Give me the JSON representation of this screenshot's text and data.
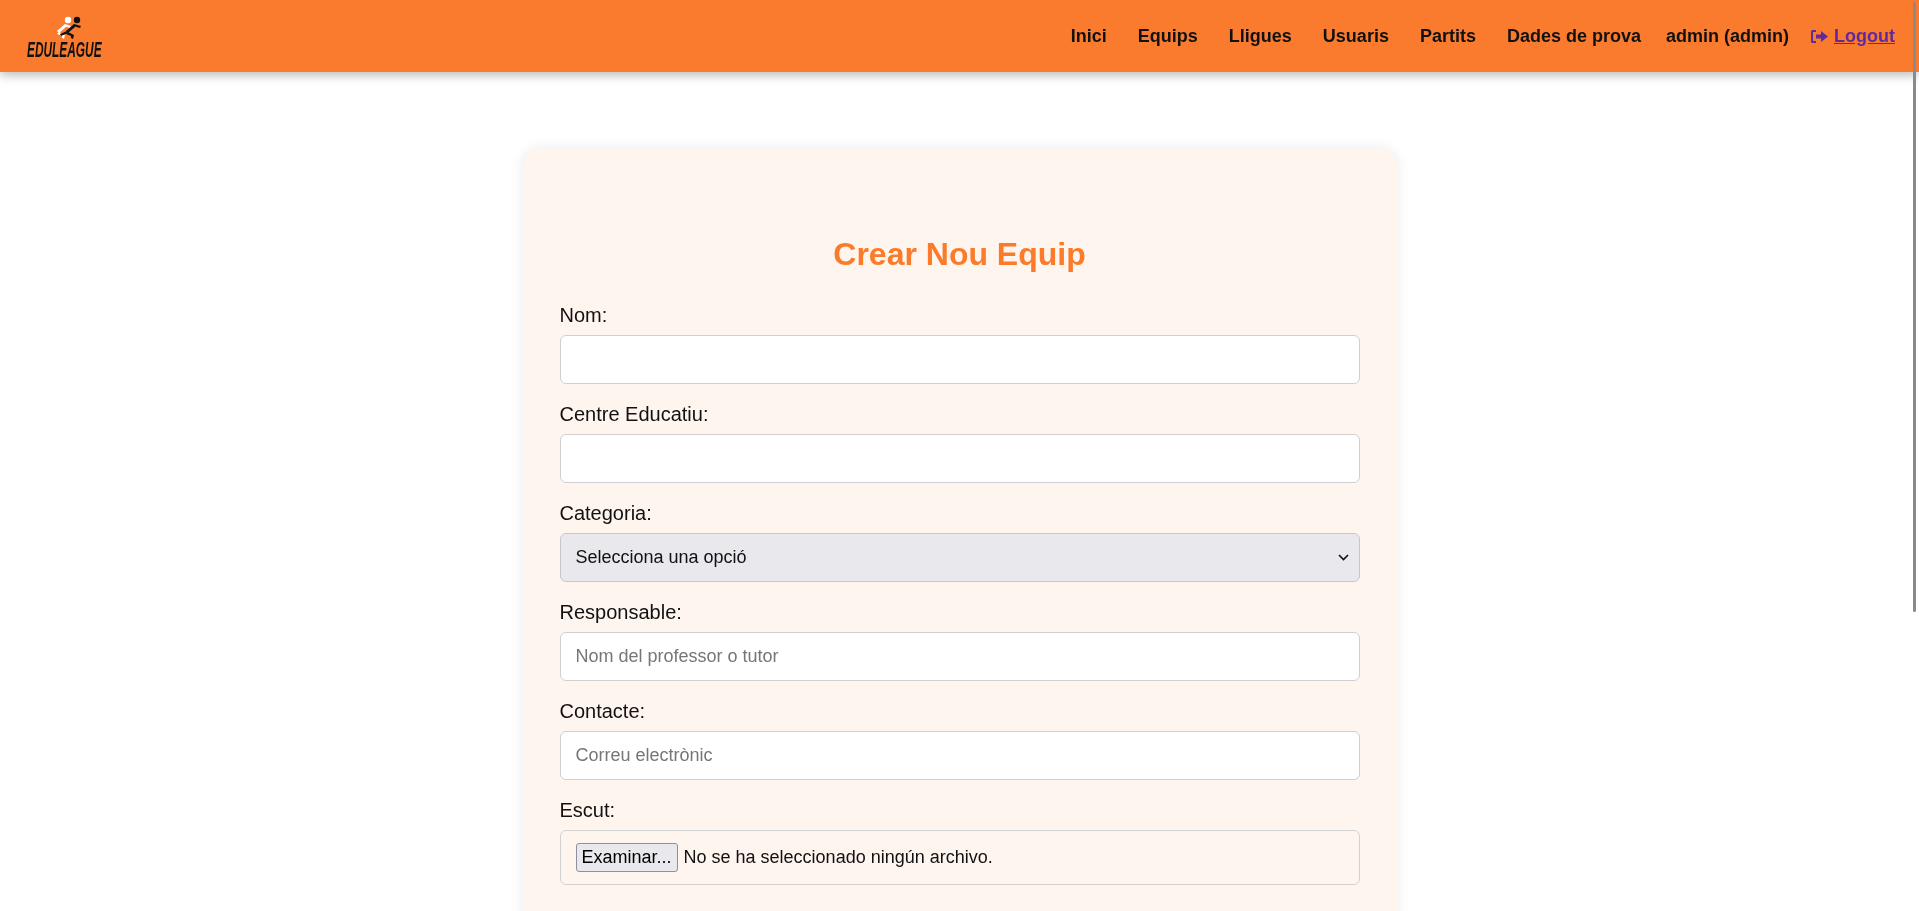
{
  "logo": {
    "text": "EDULEAGUE"
  },
  "nav": {
    "links": [
      "Inici",
      "Equips",
      "Lligues",
      "Usuaris",
      "Partits",
      "Dades de prova"
    ],
    "user": "admin (admin)",
    "logout": "Logout"
  },
  "form": {
    "title": "Crear Nou Equip",
    "fields": [
      {
        "kind": "text",
        "label": "Nom:"
      },
      {
        "kind": "text",
        "label": "Centre Educatiu:"
      },
      {
        "kind": "select",
        "label": "Categoria:",
        "value": "Selecciona una opció"
      },
      {
        "kind": "text",
        "label": "Responsable:",
        "placeholder": "Nom del professor o tutor"
      },
      {
        "kind": "text",
        "label": "Contacte:",
        "placeholder": "Correu electrònic"
      },
      {
        "kind": "file",
        "label": "Escut:",
        "button": "Examinar...",
        "status": "No se ha seleccionado ningún archivo."
      }
    ]
  }
}
